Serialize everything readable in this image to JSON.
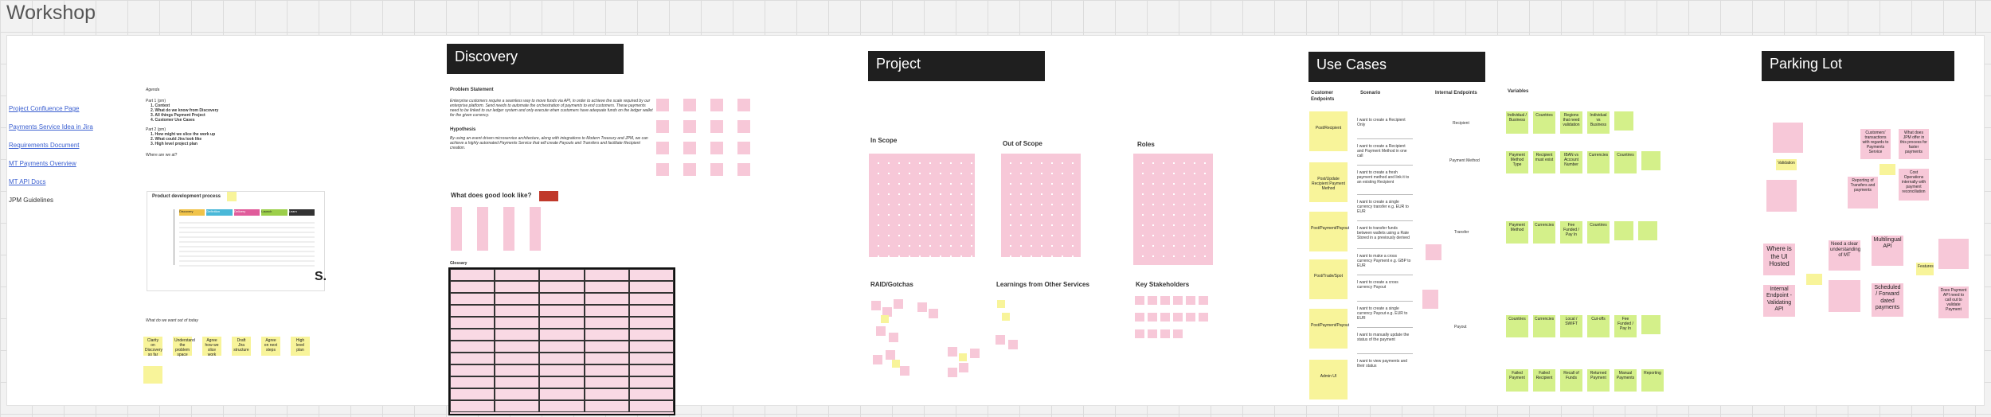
{
  "board": {
    "title": "Workshop"
  },
  "links": [
    "Project Confluence Page",
    "Payments Service Idea in Jira",
    "Requirements Document",
    "MT Payments Overview",
    "MT API Docs",
    "JPM Guidelines"
  ],
  "agenda": {
    "title": "Agenda",
    "part1": "Part 1 (pm)",
    "part1_items": [
      "1. Context",
      "2. What do we know from Discovery",
      "3. All things Payment Project",
      "4. Customer Use Cases"
    ],
    "part2": "Part 2 (pm)",
    "part2_items": [
      "1. How might we slice the work up",
      "2. What could Jira look like",
      "3. High level project plan"
    ],
    "where": "Where are we at?",
    "process_title": "Product development process",
    "process_cols": [
      "Discovery",
      "Definition",
      "Delivery",
      "Launch",
      "Learn"
    ],
    "logo": "S.",
    "want_out": "What do we want out of today"
  },
  "today_stickies": [
    "Clarity on Discovery so far",
    "Understand the problem space",
    "Agree how we slice work",
    "Draft Jira structure",
    "Agree on next steps",
    "High level plan"
  ],
  "discovery": {
    "title": "Discovery",
    "problem_title": "Problem Statement",
    "problem_text": "Enterprise customers require a seamless way to move funds via API, in order to achieve the scale required by our enterprise platform. Send needs to automate the orchestration of payments to end customers. These payments need to be linked to our ledger system and only execute when customers have adequate funds on the ledger wallet for the given currency.",
    "hypothesis_title": "Hypothesis",
    "hypothesis_text": "By using an event driven microservice architecture, along with integrations to Modern Treasury and JPM, we can achieve a highly automated Payments Service that will create Payouts and Transfers and facilitate Recipient creation.",
    "good_title": "What does good look like?",
    "glossary_title": "Glossary"
  },
  "project": {
    "title": "Project",
    "in_scope": "In Scope",
    "out_scope": "Out of Scope",
    "roles": "Roles",
    "raid": "RAID/Gotchas",
    "learnings": "Learnings from Other Services",
    "stakeholders": "Key Stakeholders"
  },
  "use_cases": {
    "title": "Use Cases",
    "col_endpoints": "Customer Endpoints",
    "col_scenario": "Scenario",
    "col_internal": "Internal Endpoints",
    "col_variables": "Variables",
    "endpoints": [
      "Post/Recipient",
      "Post/Update Recipient Payment Method",
      "Post/Payment/Payout",
      "Post/Trade/Spot",
      "Post/Payment/Payout",
      "Admin UI"
    ],
    "scenarios": [
      "I want to create a Recipient Only",
      "I want to create a Recipient and Payment Method in one call",
      "I want to create a fresh payment method and link it to an existing Recipient",
      "I want to create a single currency transfer e.g. EUR to EUR",
      "I want to transfer funds between wallets using a Rate Stored in a previously derived",
      "I want to make a cross currency Payment e.g. GBP to EUR",
      "I want to create a cross currency Payout",
      "I want to create a single currency Payout e.g. EUR to EUR",
      "I want to manually update the status of the payment",
      "I want to view payments and their status"
    ],
    "internal": [
      "Recipient",
      "Payment Method",
      "Transfer",
      "Payout"
    ],
    "variables_row1": [
      "Individual / Business",
      "Countries",
      "Regions that need validation",
      "Individual vs Business"
    ],
    "variables_row2": [
      "Payment Method Type",
      "Recipient must exist",
      "IBAN vs Account Number",
      "Currencies",
      "Countries"
    ],
    "variables_row3": [
      "Payment Method",
      "Currencies",
      "Fee Funded / Pay In",
      "Countries"
    ],
    "variables_row4": [
      "Countries",
      "Currencies",
      "Local / SWIFT",
      "Cut-offs",
      "Fee Funded / Pay In"
    ],
    "variables_row5": [
      "Failed Payment",
      "Failed Recipient",
      "Recall of Funds",
      "Returned Payment",
      "Manual Payments",
      "Reporting"
    ]
  },
  "parking_lot": {
    "title": "Parking Lot",
    "stickies": [
      "Where is the UI Hosted",
      "Internal Endpoint - Validating API",
      "Need a clear understanding of MT",
      "Multilingual API",
      "Scheduled / Forward dated payments",
      "Does Payment API need to call out to validate Payment",
      "What does JPM offer in this process for faster payments",
      "Cost Operations internally with payment reconciliation",
      "Customers' transactions with regards to Payments Service",
      "Reporting of Transfers and payments",
      "Features",
      "Validation"
    ]
  }
}
